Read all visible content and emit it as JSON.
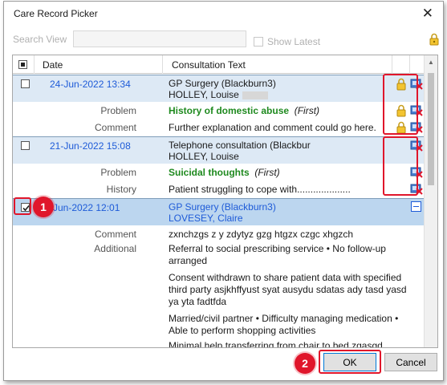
{
  "dialog": {
    "title": "Care Record Picker",
    "close_glyph": "✕"
  },
  "search": {
    "label": "Search View",
    "value": "",
    "show_latest_label": "Show Latest"
  },
  "grid": {
    "headers": {
      "date": "Date",
      "text": "Consultation Text"
    },
    "records": [
      {
        "date": "24-Jun-2022 13:34",
        "line1": "GP Surgery (Blackburn3)",
        "line2": "HOLLEY, Louise",
        "subs": [
          {
            "label": "Problem",
            "main": "History of domestic abuse",
            "extra": "(First)"
          },
          {
            "label": "Comment",
            "main": "Further explanation and comment could go here."
          }
        ]
      },
      {
        "date": "21-Jun-2022 15:08",
        "line1": "Telephone consultation (Blackbur",
        "line2": "HOLLEY, Louise",
        "subs": [
          {
            "label": "Problem",
            "main": "Suicidal thoughts",
            "extra": "(First)"
          },
          {
            "label": "History",
            "main": "Patient struggling to cope with...................."
          }
        ]
      },
      {
        "date": "24-Jun-2022 12:01",
        "date_visible": "-Jun-2022 12:01",
        "line1": "GP Surgery (Blackburn3)",
        "line2": "LOVESEY, Claire",
        "subs": [
          {
            "label": "Comment",
            "main": "zxnchzgs z y zdytyz gzg htgzx czgc xhgzch"
          },
          {
            "label": "Additional",
            "main_lines": [
              "Referral to social prescribing service  • No follow-up arranged",
              "Consent withdrawn to share patient data with specified third party asjkhffyust syat ausydu sdatas ady tasd yasd ya yta fadtfda",
              "Married/civil partner  • Difficulty managing medication  • Able to perform shopping activities",
              "Minimal help transferring from chair to bed zgasgd"
            ]
          }
        ]
      }
    ]
  },
  "callouts": {
    "one": "1",
    "two": "2"
  },
  "buttons": {
    "ok": "OK",
    "cancel": "Cancel"
  },
  "colors": {
    "accent_blue": "#1e5bd8",
    "problem_green": "#1f8a1f",
    "callout_red": "#e0162b",
    "selected_row": "#bcd6ef"
  },
  "icons": [
    "lock-icon",
    "record-status-icon"
  ]
}
